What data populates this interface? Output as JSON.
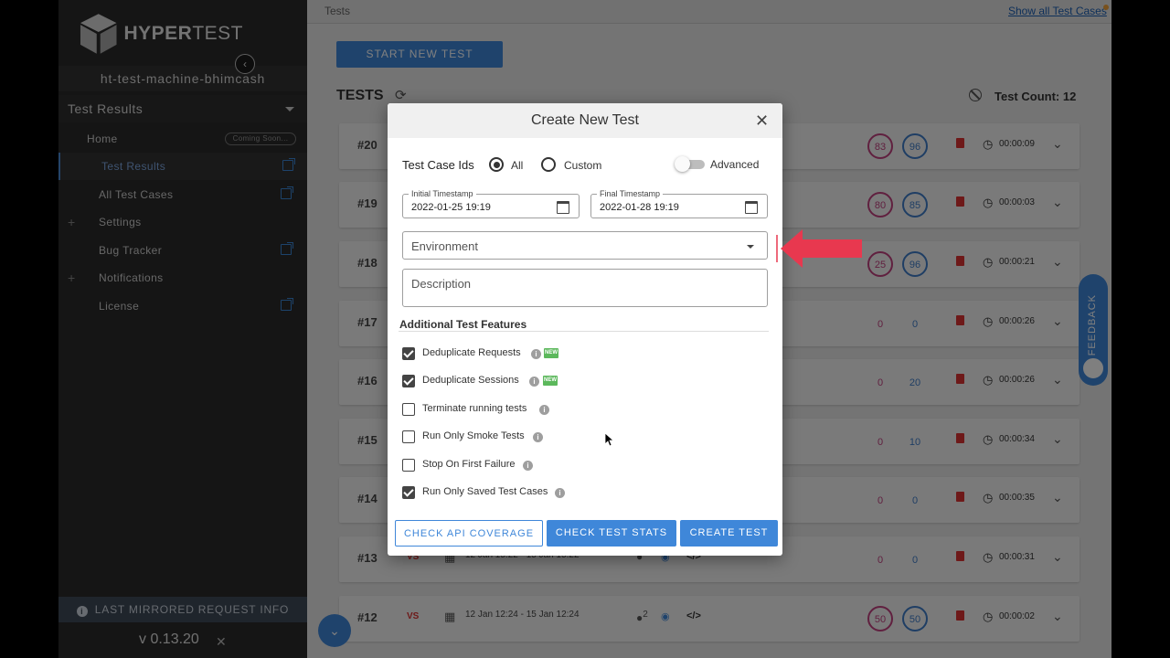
{
  "sidebar": {
    "logo_text_bold": "HYPER",
    "logo_text_rest": "TEST",
    "machine": "ht-test-machine-bhimcash",
    "section_title": "Test Results",
    "items": [
      {
        "label": "Home",
        "badge": "Coming Soon..."
      },
      {
        "label": "Test Results"
      },
      {
        "label": "All Test Cases"
      },
      {
        "label": "Settings"
      },
      {
        "label": "Bug Tracker"
      },
      {
        "label": "Notifications"
      },
      {
        "label": "License"
      }
    ],
    "footer_info": "LAST MIRRORED REQUEST INFO",
    "version": "v 0.13.20"
  },
  "main": {
    "breadcrumb": "Tests",
    "show_all": "Show all Test Cases",
    "start_button": "START NEW TEST",
    "tests_title": "TESTS",
    "test_count": "Test Count: 12",
    "rows": [
      {
        "num": "#20",
        "a": "83",
        "b": "96",
        "duration": "00:00:09"
      },
      {
        "num": "#19",
        "a": "80",
        "b": "85",
        "duration": "00:00:03"
      },
      {
        "num": "#18",
        "a": "25",
        "b": "96",
        "duration": "00:00:21"
      },
      {
        "num": "#17",
        "a": "0",
        "b": "0",
        "duration": "00:00:26"
      },
      {
        "num": "#16",
        "a": "0",
        "b": "20",
        "duration": "00:00:26"
      },
      {
        "num": "#15",
        "a": "0",
        "b": "10",
        "duration": "00:00:34"
      },
      {
        "num": "#14",
        "a": "0",
        "b": "0",
        "duration": "00:00:35"
      },
      {
        "num": "#13",
        "vs": "VS",
        "date": "12 Jan 15:22 - 15 Jan 15:22",
        "a": "0",
        "b": "0",
        "duration": "00:00:31"
      },
      {
        "num": "#12",
        "vs": "VS",
        "date": "12 Jan 12:24 - 15 Jan 12:24",
        "user_sup": "2",
        "a": "50",
        "b": "50",
        "duration": "00:00:02"
      }
    ],
    "feedback": "FEEDBACK"
  },
  "modal": {
    "title": "Create New Test",
    "test_case_ids_label": "Test Case Ids",
    "radio_all": "All",
    "radio_custom": "Custom",
    "advanced_label": "Advanced",
    "initial_ts_label": "Initial Timestamp",
    "initial_ts_value": "2022-01-25 19:19",
    "final_ts_label": "Final Timestamp",
    "final_ts_value": "2022-01-28 19:19",
    "environment_placeholder": "Environment",
    "description_placeholder": "Description",
    "features_title": "Additional Test Features",
    "features": [
      {
        "label": "Deduplicate Requests",
        "checked": true,
        "new": true
      },
      {
        "label": "Deduplicate Sessions",
        "checked": true,
        "new": true
      },
      {
        "label": "Terminate running tests",
        "checked": false
      },
      {
        "label": "Run Only Smoke Tests",
        "checked": false
      },
      {
        "label": "Stop On First Failure",
        "checked": false
      },
      {
        "label": "Run Only Saved Test Cases",
        "checked": true
      }
    ],
    "new_badge": "NEW",
    "btn_api": "CHECK API COVERAGE",
    "btn_stats": "CHECK TEST STATS",
    "btn_create": "CREATE TEST"
  },
  "colors": {
    "accent": "#3f87d9",
    "arrow": "#e8384f",
    "ring_a": "#c0407f",
    "ring_b": "#3f7cc8"
  }
}
